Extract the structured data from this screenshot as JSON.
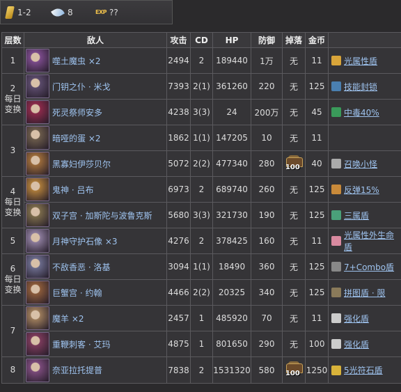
{
  "topbar": {
    "stamina": "1-2",
    "feather": "8",
    "exp_label": "EXP",
    "exp_value": "??"
  },
  "headers": [
    "层数",
    "敌人",
    "攻击",
    "CD",
    "HP",
    "防御",
    "掉落",
    "金币",
    ""
  ],
  "rows": [
    {
      "floor": "1",
      "note": "",
      "enemy": "噬土魔虫 ×2",
      "atk": "2494",
      "cd": "2",
      "hp": "189440",
      "def": "1万",
      "drop": "无",
      "gold": "11",
      "passive": "光属性盾",
      "portrait_color": "#7a4a8a",
      "picon_color": "#d9a53a"
    },
    {
      "floor": "2",
      "note": "每日\n变换",
      "enemy": "门钥之仆 · 米戈",
      "atk": "7393",
      "cd": "2(1)",
      "hp": "361260",
      "def": "220",
      "drop": "无",
      "gold": "125",
      "passive": "技能封锁",
      "portrait_color": "#5a4a6a",
      "picon_color": "#4a7fb0"
    },
    {
      "floor": "",
      "note": "",
      "enemy": "死灵祭师安多",
      "atk": "4238",
      "cd": "3(3)",
      "hp": "24",
      "def": "200万",
      "drop": "无",
      "gold": "45",
      "passive": "中毒40%",
      "portrait_color": "#8a2a4a",
      "picon_color": "#3a9a5a"
    },
    {
      "floor": "3",
      "note": "",
      "enemy": "暗哑的蛋 ×2",
      "atk": "1862",
      "cd": "1(1)",
      "hp": "147205",
      "def": "10",
      "drop": "无",
      "gold": "11",
      "passive": "",
      "portrait_color": "#6a5a4a",
      "picon_color": ""
    },
    {
      "floor": "",
      "note": "",
      "enemy": "黑寡妇伊莎贝尔",
      "atk": "5072",
      "cd": "2(2)",
      "hp": "477340",
      "def": "280",
      "drop": "chest",
      "drop_count": "100",
      "gold": "40",
      "passive": "召唤小怪",
      "portrait_color": "#9a6a3a",
      "picon_color": "#aaaaaa"
    },
    {
      "floor": "4",
      "note": "每日\n变换",
      "enemy": "鬼神 · 吕布",
      "atk": "6973",
      "cd": "2",
      "hp": "689740",
      "def": "260",
      "drop": "无",
      "gold": "125",
      "passive": "反弹15%",
      "portrait_color": "#aa7a3a",
      "picon_color": "#c98a3a"
    },
    {
      "floor": "",
      "note": "",
      "enemy": "双子宫 · 加斯陀与波鲁克斯",
      "atk": "5680",
      "cd": "3(3)",
      "hp": "321730",
      "def": "190",
      "drop": "无",
      "gold": "125",
      "passive": "三属盾",
      "portrait_color": "#7a6a4a",
      "picon_color": "#4aa07a"
    },
    {
      "floor": "5",
      "note": "",
      "enemy": "月神守护石像 ×3",
      "atk": "4276",
      "cd": "2",
      "hp": "378425",
      "def": "160",
      "drop": "无",
      "gold": "11",
      "passive": "光属性外生命盾",
      "portrait_color": "#8a7a9a",
      "picon_color": "#d98aa0"
    },
    {
      "floor": "6",
      "note": "每日\n变换",
      "enemy": "不敌香恶 · 洛基",
      "atk": "3094",
      "cd": "1(1)",
      "hp": "18490",
      "def": "360",
      "drop": "无",
      "gold": "125",
      "passive": "7+Combo盾",
      "portrait_color": "#6a6a8a",
      "picon_color": "#888888"
    },
    {
      "floor": "",
      "note": "",
      "enemy": "巨蟹宫 · 约翰",
      "atk": "4466",
      "cd": "2(2)",
      "hp": "20325",
      "def": "340",
      "drop": "无",
      "gold": "125",
      "passive": "拼图盾 · 限",
      "portrait_color": "#8a5a3a",
      "picon_color": "#8a7a5a"
    },
    {
      "floor": "7",
      "note": "",
      "enemy": "魔羊 ×2",
      "atk": "2457",
      "cd": "1",
      "hp": "485920",
      "def": "70",
      "drop": "无",
      "gold": "11",
      "passive": "强化盾",
      "portrait_color": "#9a7a5a",
      "picon_color": "#cccccc"
    },
    {
      "floor": "",
      "note": "",
      "enemy": "重鞭刺客 · 艾玛",
      "atk": "4875",
      "cd": "1",
      "hp": "801650",
      "def": "290",
      "drop": "无",
      "gold": "100",
      "passive": "强化盾",
      "portrait_color": "#7a3a5a",
      "picon_color": "#cccccc"
    },
    {
      "floor": "8",
      "note": "",
      "enemy": "奈亚拉托提普",
      "atk": "7838",
      "cd": "2",
      "hp": "1531320",
      "def": "580",
      "drop": "chest",
      "drop_count": "100",
      "gold": "1250",
      "passive": "5光符石盾",
      "portrait_color": "#7a4a7a",
      "picon_color": "#d9b33a"
    }
  ]
}
